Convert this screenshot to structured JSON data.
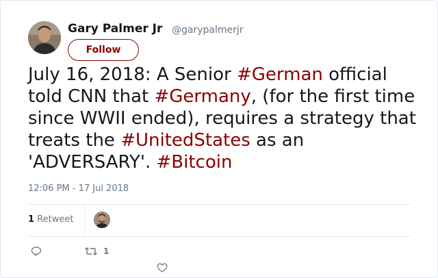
{
  "user": {
    "name": "Gary Palmer Jr",
    "handle": "@garypalmerjr",
    "follow_label": "Follow"
  },
  "tweet": {
    "segments": [
      {
        "text": "July 16, 2018: A Senior ",
        "hashtag": false
      },
      {
        "text": "#German",
        "hashtag": true
      },
      {
        "text": " official told CNN that ",
        "hashtag": false
      },
      {
        "text": "#Germany",
        "hashtag": true
      },
      {
        "text": ", (for the first time since WWII ended), requires a strategy that treats the ",
        "hashtag": false
      },
      {
        "text": "#UnitedStates",
        "hashtag": true
      },
      {
        "text": " as an 'ADVERSARY'. ",
        "hashtag": false
      },
      {
        "text": "#Bitcoin",
        "hashtag": true
      }
    ],
    "timestamp": "12:06 PM - 17 Jul 2018"
  },
  "stats": {
    "retweet_count": "1",
    "retweet_label": "Retweet"
  },
  "actions": {
    "reply_icon": "reply-icon",
    "retweet_icon": "retweet-icon",
    "retweet_count": "1",
    "like_icon": "heart-icon"
  },
  "colors": {
    "accent": "#8b0000",
    "text": "#14171a",
    "muted": "#657786"
  }
}
